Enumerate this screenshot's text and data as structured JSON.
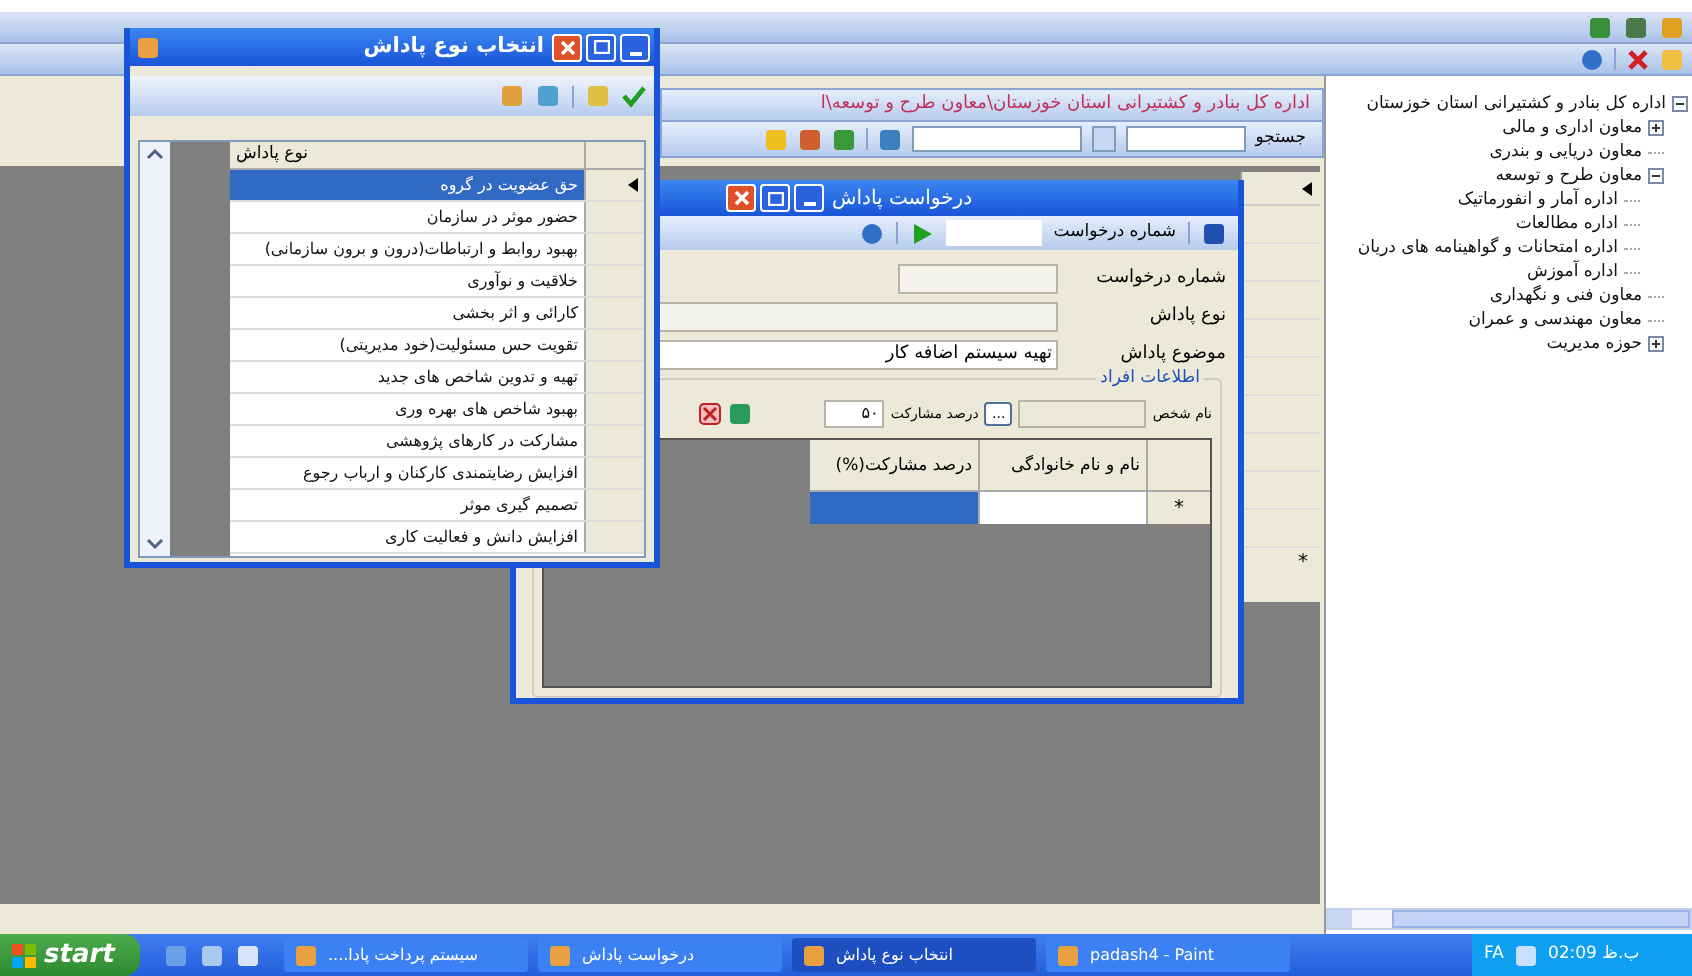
{
  "breadcrumb": "اداره کل بنادر و کشتیرانی استان خوزستان\\معاون طرح و توسعه\\ا",
  "search": {
    "label": "جستجو"
  },
  "tree": {
    "items": [
      {
        "label": "اداره کل بنادر و کشتیرانی استان خوزستان",
        "expanded": true,
        "children": [
          {
            "label": "معاون اداری و مالی",
            "expanded": false
          },
          {
            "label": "معاون دریایی و بندری"
          },
          {
            "label": "معاون طرح و توسعه",
            "expanded": true,
            "children": [
              {
                "label": "اداره آمار و انفورماتیک"
              },
              {
                "label": "اداره مطالعات"
              },
              {
                "label": "اداره امتحانات و گواهینامه های دریان"
              },
              {
                "label": "اداره آموزش"
              }
            ]
          },
          {
            "label": "معاون فنی و نگهداری"
          },
          {
            "label": "معاون مهندسی و عمران"
          },
          {
            "label": "حوزه مدیریت",
            "expanded": false
          }
        ]
      }
    ]
  },
  "background_grid": {
    "new_row_mark": "*"
  },
  "reward_dialog": {
    "title": "درخواست پاداش",
    "toolbar_label": "شماره درخواست",
    "fields": [
      {
        "label": "شماره درخواست"
      },
      {
        "label": "نوع پاداش"
      },
      {
        "label": "موضوع پاداش",
        "value": "تهیه سیستم اضافه کار"
      }
    ],
    "section": "اطلاعات افراد",
    "person_label": "نام شخص",
    "browse": "...",
    "percent_label": "درصد مشارکت",
    "percent": "۵۰",
    "columns": [
      "نام و نام خانوادگی",
      "درصد مشارکت(%)"
    ],
    "new_row_mark": "*"
  },
  "type_popup": {
    "title": "انتخاب نوع پاداش",
    "column": "نوع پاداش",
    "rows": [
      {
        "label": "حق عضویت در گروه",
        "selected": true
      },
      {
        "label": "حضور موثر در سازمان",
        "selected": false
      },
      {
        "label": "بهبود روابط و ارتباطات(درون و برون سازمانی)",
        "selected": false
      },
      {
        "label": "خلاقیت و نوآوری",
        "selected": false
      },
      {
        "label": "کارائی و اثر بخشی",
        "selected": false
      },
      {
        "label": "تقویت حس مسئولیت(خود مدیریتی)",
        "selected": false
      },
      {
        "label": "تهیه و تدوین شاخص های جدید",
        "selected": false
      },
      {
        "label": "بهبود شاخص های بهره وری",
        "selected": false
      },
      {
        "label": "مشارکت در کارهای پژوهشی",
        "selected": false
      },
      {
        "label": "افزایش رضایتمندی کارکنان و ارباب رجوع",
        "selected": false
      },
      {
        "label": "تصمیم گیری موثر",
        "selected": false
      },
      {
        "label": "افزایش دانش و فعالیت کاری",
        "selected": false
      }
    ]
  },
  "taskbar": {
    "start": "start",
    "tasks": [
      {
        "label": "padash4 - Paint",
        "selected": false
      },
      {
        "label": "انتخاب نوع پاداش",
        "selected": true
      },
      {
        "label": "درخواست پاداش",
        "selected": false
      },
      {
        "label": "سیستم پرداخت پادا....",
        "selected": false
      }
    ],
    "language": "FA",
    "clock": "02:09 ب.ظ"
  }
}
